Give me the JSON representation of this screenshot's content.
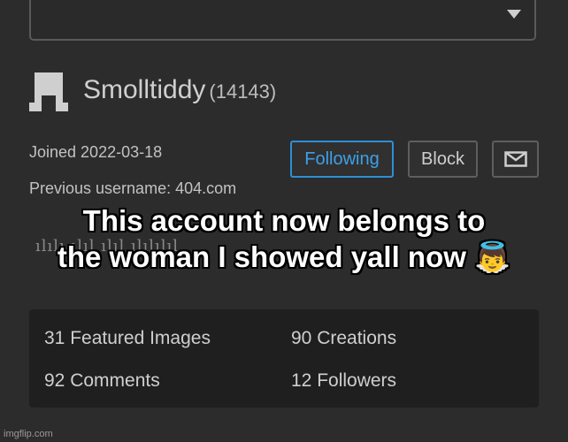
{
  "profile": {
    "username": "Smolltiddy",
    "points": "(14143)",
    "joined": "Joined 2022-03-18",
    "previous_username": "Previous username: 404.com"
  },
  "actions": {
    "following_label": "Following",
    "block_label": "Block",
    "message_icon": "envelope-icon"
  },
  "meme_caption": {
    "line1": "This account now belongs to",
    "line2": "the woman I showed yall now 👼"
  },
  "obscured_text": "ılılı ılıl ılıl ılılılıl",
  "stats": {
    "featured_images": "31 Featured Images",
    "creations": "90 Creations",
    "comments": "92 Comments",
    "followers": "12 Followers"
  },
  "watermark": "imgflip.com",
  "colors": {
    "background": "#2c2c2c",
    "accent_blue": "#2d8fd6",
    "stats_panel": "#1f1f1f"
  }
}
